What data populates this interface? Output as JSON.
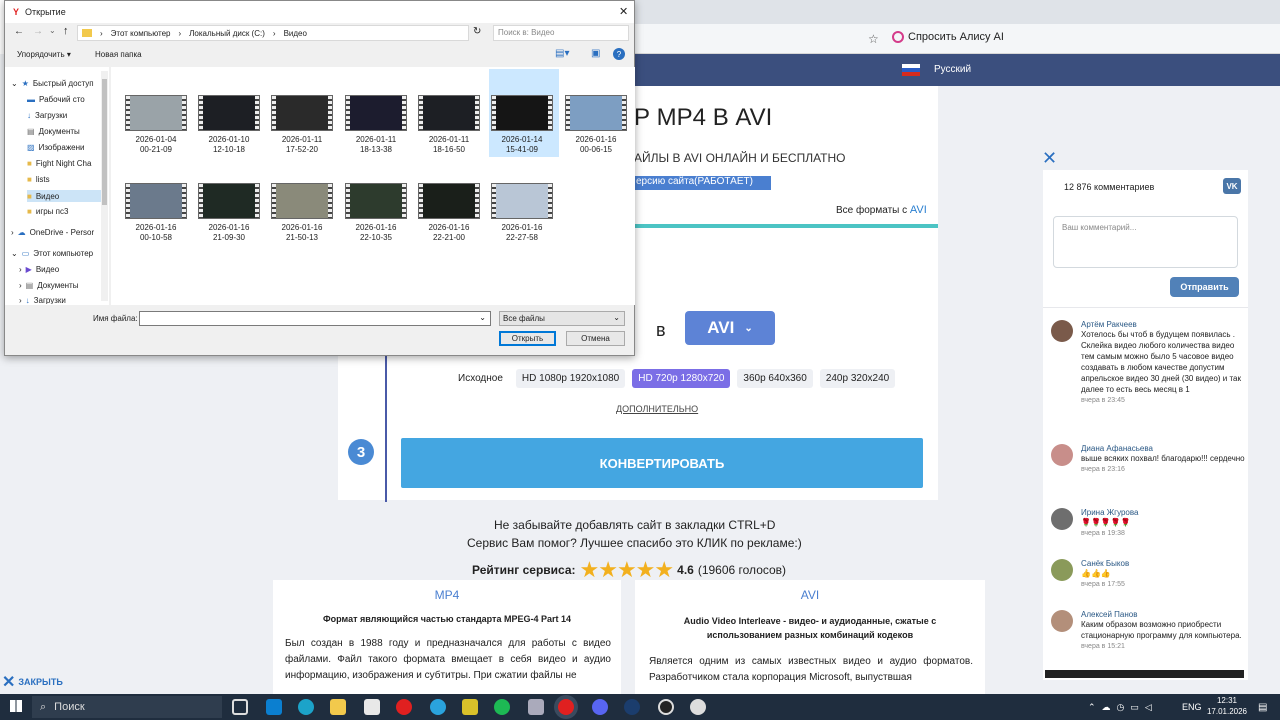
{
  "dialog": {
    "title": "Открытие",
    "path": [
      "Этот компьютер",
      "Локальный диск (C:)",
      "Видео"
    ],
    "search_placeholder": "Поиск в: Видео",
    "organize": "Упорядочить ▾",
    "new_folder": "Новая папка",
    "tree": [
      "Быстрый доступ",
      "Рабочий сто",
      "Загрузки",
      "Документы",
      "Изображени",
      "Fight Night Cha",
      "lists",
      "Видео",
      "игры пс3",
      "OneDrive - Persor",
      "Этот компьютер",
      "Видео",
      "Документы",
      "Загрузки"
    ],
    "files": [
      {
        "date": "2026-01-04",
        "time": "00-21-09"
      },
      {
        "date": "2026-01-10",
        "time": "12-10-18"
      },
      {
        "date": "2026-01-11",
        "time": "17-52-20"
      },
      {
        "date": "2026-01-11",
        "time": "18-13-38"
      },
      {
        "date": "2026-01-11",
        "time": "18-16-50"
      },
      {
        "date": "2026-01-14",
        "time": "15-41-09"
      },
      {
        "date": "2026-01-16",
        "time": "00-06-15"
      },
      {
        "date": "2026-01-16",
        "time": "00-10-58"
      },
      {
        "date": "2026-01-16",
        "time": "21-09-30"
      },
      {
        "date": "2026-01-16",
        "time": "21-50-13"
      },
      {
        "date": "2026-01-16",
        "time": "22-10-35"
      },
      {
        "date": "2026-01-16",
        "time": "22-21-00"
      },
      {
        "date": "2026-01-16",
        "time": "22-27-58"
      }
    ],
    "filename_label": "Имя файла:",
    "filetype": "Все файлы",
    "open": "Открыть",
    "cancel": "Отмена"
  },
  "browser": {
    "alice": "Спросить Алису AI",
    "language": "Русский"
  },
  "page": {
    "title": "Р MP4 В AVI",
    "subtitle": "АЙЛЫ В AVI ОНЛАЙН И БЕСПЛАТНО",
    "version_link": "ерсию сайта(РАБОТАЕТ)",
    "all_formats": "Все форматы с ",
    "all_formats_link": "AVI",
    "in": "в",
    "target_format": "AVI",
    "qualities": [
      "Исходное",
      "HD 1080p 1920x1080",
      "HD 720p 1280x720",
      "360p 640x360",
      "240p 320x240"
    ],
    "additional": "ДОПОЛНИТЕЛЬНО",
    "step3": "3",
    "convert": "КОНВЕРТИРОВАТЬ",
    "reminder": "Не забывайте добавлять сайт в закладки CTRL+D",
    "ads": "Сервис Вам помог? Лучшее спасибо это КЛИК по рекламе:)",
    "rating_label": "Рейтинг сервиса:",
    "stars": "★★★★★",
    "rating_value": "4.6",
    "rating_votes": "(19606 голосов)",
    "rating": 4.6,
    "mp4_tag": "MP4",
    "avi_tag": "AVI",
    "mp4_title": "Формат являющийся частью стандарта MPEG-4 Part 14",
    "mp4_text": "Был создан в 1988 году и предназначался для работы с видео файлами. Файл такого формата вмещает в себя видео и аудио информацию, изображения и субтитры. При сжатии файлы не",
    "avi_title": "Audio Video Interleave - видео- и аудиоданные, сжатые с использованием разных комбинаций кодеков",
    "avi_text": "Является одним из самых известных видео и аудио форматов. Разработчиком стала корпорация Microsoft, выпуствшая",
    "close": "ЗАКРЫТЬ"
  },
  "comments": {
    "count": "12 876 комментариев",
    "placeholder": "Ваш комментарий...",
    "send": "Отправить",
    "items": [
      {
        "name": "Артём Ракчеев",
        "text": "Хотелось бы чтоб в будущем появилась . Склейка видео любого количества видео тем самым можно было 5 часовое видео создавать в любом качестве допустим апрельское видео 30 дней (30 видео) и так далее то есть весь месяц в 1",
        "time": "вчера в 23:45"
      },
      {
        "name": "Диана Афанасьева",
        "text": "выше всяких похвал! благодарю!!! сердечно",
        "time": "вчера в 23:16"
      },
      {
        "name": "Ирина Жгурова",
        "text": "🌹🌹🌹🌹🌹",
        "time": "вчера в 19:38"
      },
      {
        "name": "Санёк Быков",
        "text": "👍👍👍",
        "time": "вчера в 17:55"
      },
      {
        "name": "Алексей Панов",
        "text": "Каким образом возможно приобрести стационарную программу для компьютера.",
        "time": "вчера в 15:21"
      }
    ]
  },
  "taskbar": {
    "search": "Поиск",
    "lang": "ENG",
    "time": "12:31",
    "date": "17.01.2026"
  }
}
